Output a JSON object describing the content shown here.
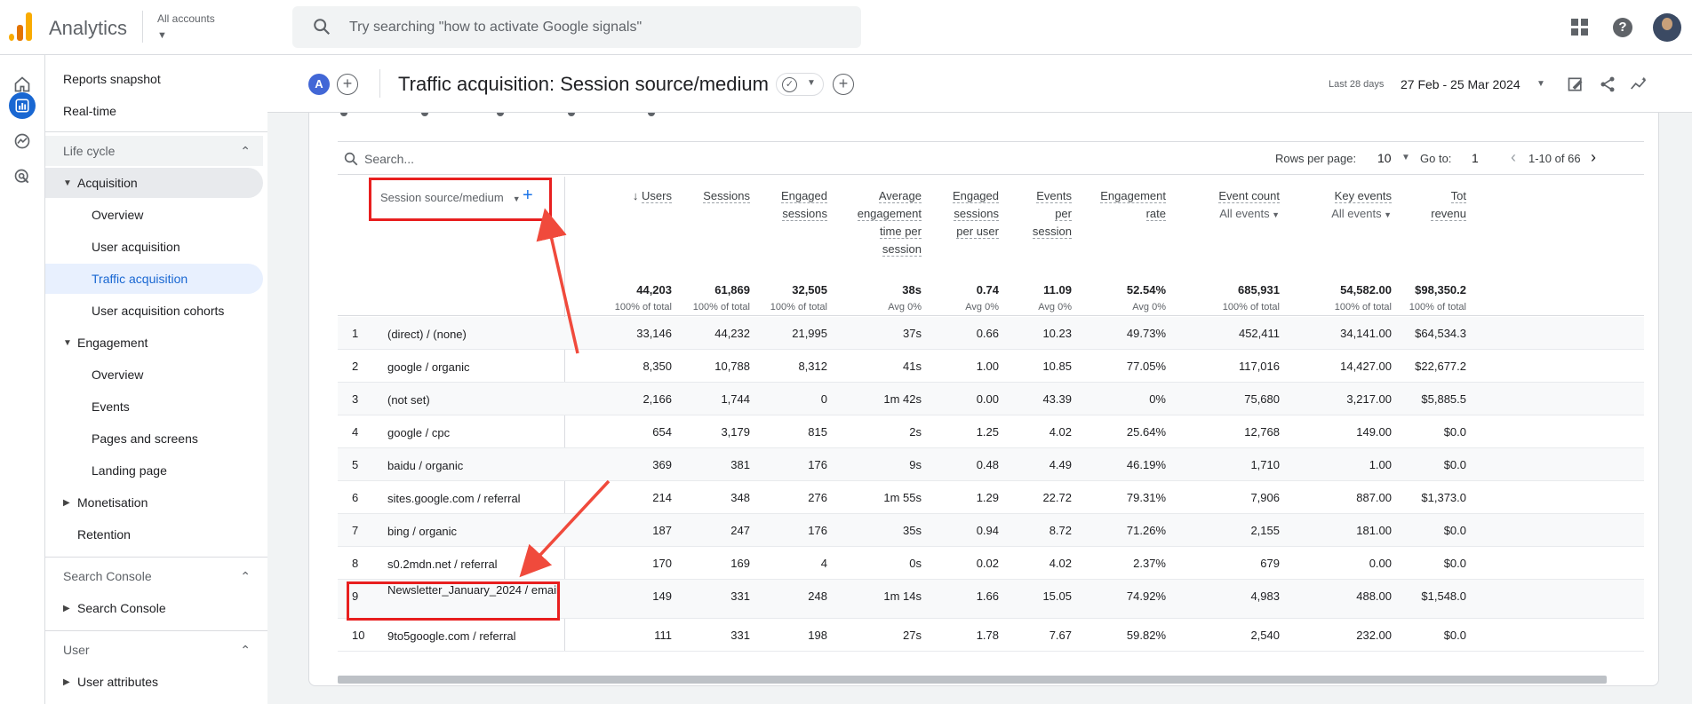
{
  "app": {
    "name": "Analytics",
    "accounts_label": "All accounts"
  },
  "search": {
    "placeholder": "Try searching \"how to activate Google signals\""
  },
  "sidebar": {
    "reports_snapshot": "Reports snapshot",
    "realtime": "Real-time",
    "lifecycle": "Life cycle",
    "acquisition": "Acquisition",
    "acq_overview": "Overview",
    "user_acquisition": "User acquisition",
    "traffic_acquisition": "Traffic acquisition",
    "user_acq_cohorts": "User acquisition cohorts",
    "engagement": "Engagement",
    "eng_overview": "Overview",
    "events": "Events",
    "pages_screens": "Pages and screens",
    "landing_page": "Landing page",
    "monetisation": "Monetisation",
    "retention": "Retention",
    "search_console_section": "Search Console",
    "search_console_item": "Search Console",
    "user_section": "User",
    "user_attributes": "User attributes"
  },
  "header": {
    "badge": "A",
    "title": "Traffic acquisition: Session source/medium",
    "date_label": "Last 28 days",
    "date_range": "27 Feb - 25 Mar 2024"
  },
  "toolbar": {
    "search_placeholder": "Search...",
    "rows_per_page_label": "Rows per page:",
    "rows_per_page": "10",
    "goto_label": "Go to:",
    "goto_value": "1",
    "range": "1-10 of 66"
  },
  "table": {
    "dimension": "Session source/medium",
    "columns": [
      {
        "l1": "Users",
        "l2": "",
        "l3": "",
        "l4": "",
        "sub": ""
      },
      {
        "l1": "Sessions",
        "l2": "",
        "l3": "",
        "l4": "",
        "sub": ""
      },
      {
        "l1": "Engaged",
        "l2": "sessions",
        "l3": "",
        "l4": "",
        "sub": ""
      },
      {
        "l1": "Average",
        "l2": "engagement",
        "l3": "time per",
        "l4": "session",
        "sub": ""
      },
      {
        "l1": "Engaged",
        "l2": "sessions",
        "l3": "per user",
        "l4": "",
        "sub": ""
      },
      {
        "l1": "Events",
        "l2": "per",
        "l3": "session",
        "l4": "",
        "sub": ""
      },
      {
        "l1": "Engagement",
        "l2": "rate",
        "l3": "",
        "l4": "",
        "sub": ""
      },
      {
        "l1": "Event count",
        "l2": "",
        "l3": "",
        "l4": "",
        "sub": "All events"
      },
      {
        "l1": "Key events",
        "l2": "",
        "l3": "",
        "l4": "",
        "sub": "All events"
      },
      {
        "l1": "Tot",
        "l2": "revenu",
        "l3": "",
        "l4": "",
        "sub": ""
      }
    ],
    "totals": [
      "44,203",
      "61,869",
      "32,505",
      "38s",
      "0.74",
      "11.09",
      "52.54%",
      "685,931",
      "54,582.00",
      "$98,350.2"
    ],
    "totals_sub": [
      "100% of total",
      "100% of total",
      "100% of total",
      "Avg 0%",
      "Avg 0%",
      "Avg 0%",
      "Avg 0%",
      "100% of total",
      "100% of total",
      "100% of total"
    ],
    "rows": [
      {
        "idx": "1",
        "dim": "(direct) / (none)",
        "v": [
          "33,146",
          "44,232",
          "21,995",
          "37s",
          "0.66",
          "10.23",
          "49.73%",
          "452,411",
          "34,141.00",
          "$64,534.3"
        ]
      },
      {
        "idx": "2",
        "dim": "google / organic",
        "v": [
          "8,350",
          "10,788",
          "8,312",
          "41s",
          "1.00",
          "10.85",
          "77.05%",
          "117,016",
          "14,427.00",
          "$22,677.2"
        ]
      },
      {
        "idx": "3",
        "dim": "(not set)",
        "v": [
          "2,166",
          "1,744",
          "0",
          "1m 42s",
          "0.00",
          "43.39",
          "0%",
          "75,680",
          "3,217.00",
          "$5,885.5"
        ]
      },
      {
        "idx": "4",
        "dim": "google / cpc",
        "v": [
          "654",
          "3,179",
          "815",
          "2s",
          "1.25",
          "4.02",
          "25.64%",
          "12,768",
          "149.00",
          "$0.0"
        ]
      },
      {
        "idx": "5",
        "dim": "baidu / organic",
        "v": [
          "369",
          "381",
          "176",
          "9s",
          "0.48",
          "4.49",
          "46.19%",
          "1,710",
          "1.00",
          "$0.0"
        ]
      },
      {
        "idx": "6",
        "dim": "sites.google.com / referral",
        "v": [
          "214",
          "348",
          "276",
          "1m 55s",
          "1.29",
          "22.72",
          "79.31%",
          "7,906",
          "887.00",
          "$1,373.0"
        ]
      },
      {
        "idx": "7",
        "dim": "bing / organic",
        "v": [
          "187",
          "247",
          "176",
          "35s",
          "0.94",
          "8.72",
          "71.26%",
          "2,155",
          "181.00",
          "$0.0"
        ]
      },
      {
        "idx": "8",
        "dim": "s0.2mdn.net / referral",
        "v": [
          "170",
          "169",
          "4",
          "0s",
          "0.02",
          "4.02",
          "2.37%",
          "679",
          "0.00",
          "$0.0"
        ]
      },
      {
        "idx": "9",
        "dim": "Newsletter_January_2024 / email",
        "v": [
          "149",
          "331",
          "248",
          "1m 14s",
          "1.66",
          "15.05",
          "74.92%",
          "4,983",
          "488.00",
          "$1,548.0"
        ]
      },
      {
        "idx": "10",
        "dim": "9to5google.com / referral",
        "v": [
          "111",
          "331",
          "198",
          "27s",
          "1.78",
          "7.67",
          "59.82%",
          "2,540",
          "232.00",
          "$0.0"
        ]
      }
    ]
  },
  "colors": {
    "accent": "#1967d2",
    "annotation": "#e81f1f",
    "logo": "#f9ab00"
  }
}
